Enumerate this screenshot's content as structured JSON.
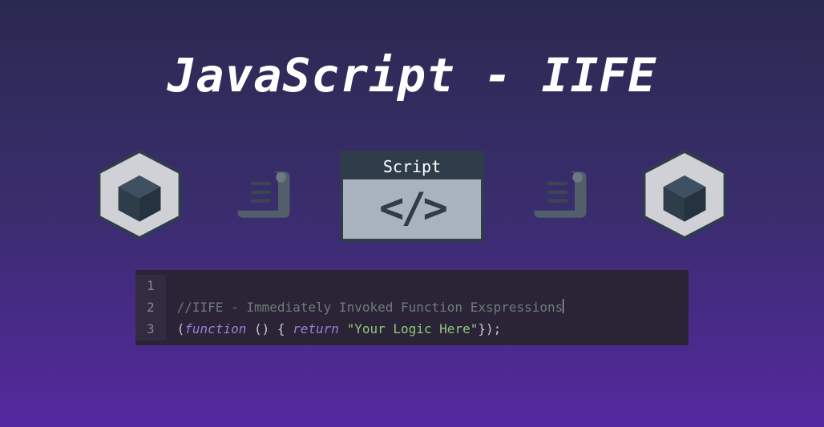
{
  "title": "JavaScript - IIFE",
  "scriptBox": {
    "header": "Script",
    "body": "</>"
  },
  "code": {
    "lineNumbers": [
      "1",
      "2",
      "3"
    ],
    "line2": {
      "comment": "//IIFE - Immediately Invoked Function Exspressions"
    },
    "line3": {
      "p1": "(",
      "kw_function": "function",
      "p2": " () { ",
      "kw_return": "return",
      "p3": " ",
      "str": "\"Your Logic Here\"",
      "p4": "});"
    }
  },
  "icons": {
    "cube": "cube-icon",
    "scroll": "scroll-icon",
    "script": "script-box"
  }
}
